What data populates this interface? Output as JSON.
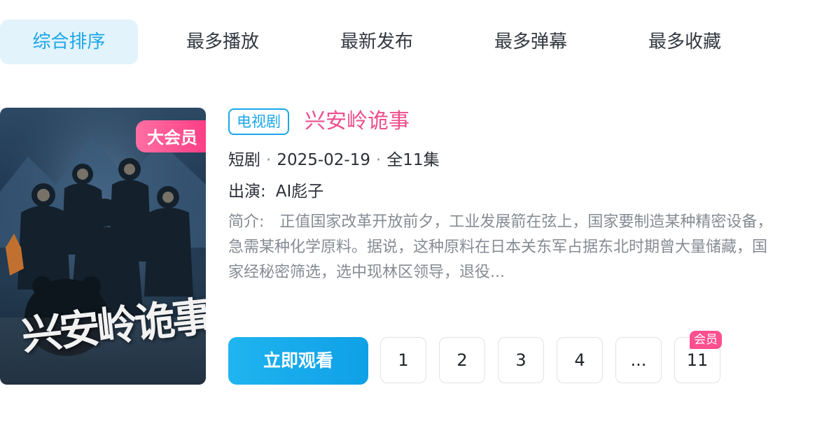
{
  "sort_tabs": [
    {
      "label": "综合排序",
      "active": true
    },
    {
      "label": "最多播放",
      "active": false
    },
    {
      "label": "最新发布",
      "active": false
    },
    {
      "label": "最多弹幕",
      "active": false
    },
    {
      "label": "最多收藏",
      "active": false
    }
  ],
  "card": {
    "poster": {
      "vip_badge": "大会员",
      "title_art": "兴安岭诡事"
    },
    "type_tag": "电视剧",
    "title": "兴安岭诡事",
    "meta": {
      "genre": "短剧",
      "date": "2025-02-19",
      "episodes": "全11集",
      "separator": "·"
    },
    "cast": {
      "label": "出演:",
      "value": "AI彪子"
    },
    "intro": {
      "label": "简介:",
      "text": "正值国家改革开放前夕，工业发展箭在弦上，国家要制造某种精密设备，急需某种化学原料。据说，这种原料在日本关东军占据东北时期曾大量储藏，国家经秘密筛选，选中现林区领导，退役..."
    },
    "watch_button": "立即观看",
    "episode_buttons": [
      {
        "label": "1"
      },
      {
        "label": "2"
      },
      {
        "label": "3"
      },
      {
        "label": "4"
      },
      {
        "label": "..."
      },
      {
        "label": "11",
        "badge": "会员"
      }
    ]
  },
  "colors": {
    "accent_blue": "#1aa6e8",
    "title_pink": "#ee4f8c",
    "vip_pink": "#ff4f8f",
    "tab_active_bg": "#e3f3fc"
  }
}
